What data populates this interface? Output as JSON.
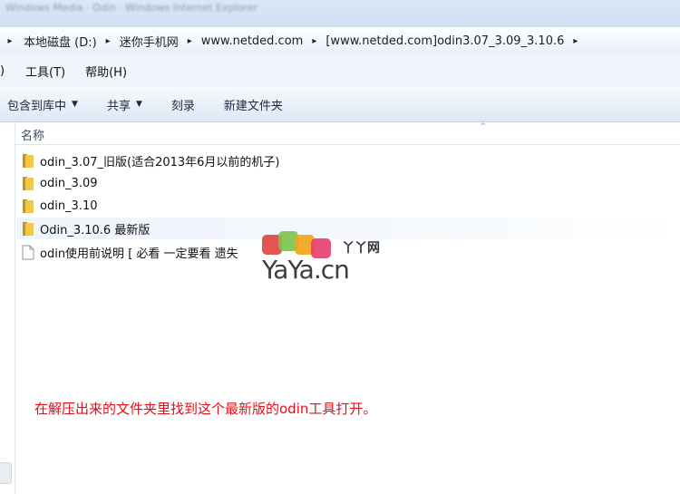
{
  "window_title_blurred": "Windows Media · Odin · Windows Internet Explorer",
  "address": {
    "crumbs": [
      "本地磁盘 (D:)",
      "迷你手机网",
      "www.netded.com",
      "[www.netded.com]odin3.07_3.09_3.10.6"
    ],
    "separator": "▸"
  },
  "menu": {
    "fragment": ")",
    "items": [
      "工具(T)",
      "帮助(H)"
    ]
  },
  "commands": {
    "include_library": "包含到库中",
    "share": "共享",
    "burn": "刻录",
    "new_folder": "新建文件夹"
  },
  "columns": {
    "name": "名称"
  },
  "files": [
    {
      "name": "odin_3.07_旧版(适合2013年6月以前的机子)",
      "type": "folder"
    },
    {
      "name": "odin_3.09",
      "type": "folder"
    },
    {
      "name": "odin_3.10",
      "type": "folder"
    },
    {
      "name": "Odin_3.10.6 最新版",
      "type": "folder",
      "selected": true
    },
    {
      "name": "odin使用前说明 [ 必看 一定要看 遗失",
      "type": "text-file"
    }
  ],
  "watermark": {
    "brand": "YaYa.cn",
    "suffix": "丫丫网"
  },
  "annotation": "在解压出来的文件夹里找到这个最新版的odin工具打开。",
  "colors": {
    "annotation": "#e0101a",
    "folder": "#e8b93a",
    "selection": "#eef4fb"
  }
}
